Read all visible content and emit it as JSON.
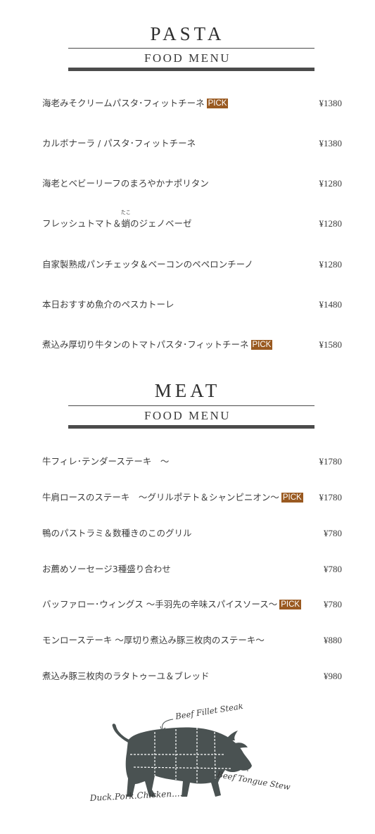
{
  "pasta": {
    "title": "PASTA",
    "subtitle": "FOOD MENU",
    "items": [
      {
        "name": "海老みそクリームパスタ･フィットチーネ",
        "pick": "PICK",
        "price": "¥1380"
      },
      {
        "name": "カルボナーラ / パスタ･フィットチーネ",
        "price": "¥1380"
      },
      {
        "name": "海老とベビーリーフのまろやかナポリタン",
        "price": "¥1280"
      },
      {
        "name_pre": "フレッシュトマト＆",
        "ruby_base": "蛸",
        "ruby_text": "たこ",
        "name_post": "のジェノベーゼ",
        "price": "¥1280"
      },
      {
        "name": "自家製熟成パンチェッタ＆ベーコンのペペロンチーノ",
        "price": "¥1280"
      },
      {
        "name": "本日おすすめ魚介のペスカトーレ",
        "price": "¥1480"
      },
      {
        "name": "煮込み厚切り牛タンのトマトパスタ･フィットチーネ",
        "pick": "PICK",
        "price": "¥1580"
      }
    ]
  },
  "meat": {
    "title": "MEAT",
    "subtitle": "FOOD MENU",
    "items": [
      {
        "name": "牛フィレ･テンダーステーキ　〜",
        "price": "¥1780"
      },
      {
        "name": "牛肩ロースのステーキ　〜グリルポテト＆シャンピニオン〜",
        "pick": "PICK",
        "price": "¥1780"
      },
      {
        "name": "鴨のパストラミ＆数種きのこのグリル",
        "price": "¥780"
      },
      {
        "name": "お薦めソーセージ3種盛り合わせ",
        "price": "¥780"
      },
      {
        "name": "バッファロー･ウィングス 〜手羽先の辛味スパイスソース〜",
        "pick": "PICK",
        "price": "¥780"
      },
      {
        "name": "モンローステーキ 〜厚切り煮込み豚三枚肉のステーキ〜",
        "price": "¥880"
      },
      {
        "name": "煮込み豚三枚肉のラタトゥーユ＆ブレッド",
        "price": "¥980"
      }
    ]
  },
  "illustration": {
    "label_fillet": "Beef Fillet Steak",
    "label_tongue": "Beef Tongue Stew",
    "label_bottom": "Duck.Pork.Chicken....",
    "bull_color": "#4a5252"
  },
  "colors": {
    "pick_bg": "#9a5a21",
    "rule": "#4b4b4b",
    "text": "#3c3c3c"
  }
}
